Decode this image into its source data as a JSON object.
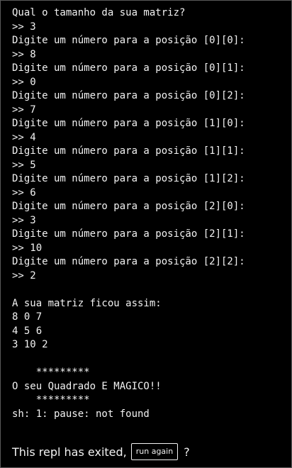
{
  "console": {
    "lines": [
      "Qual o tamanho da sua matriz?",
      ">> 3",
      "Digite um número para a posição [0][0]:",
      ">> 8",
      "Digite um número para a posição [0][1]:",
      ">> 0",
      "Digite um número para a posição [0][2]:",
      ">> 7",
      "Digite um número para a posição [1][0]:",
      ">> 4",
      "Digite um número para a posição [1][1]:",
      ">> 5",
      "Digite um número para a posição [1][2]:",
      ">> 6",
      "Digite um número para a posição [2][0]:",
      ">> 3",
      "Digite um número para a posição [2][1]:",
      ">> 10",
      "Digite um número para a posição [2][2]:",
      ">> 2",
      "",
      "A sua matriz ficou assim:",
      "8 0 7",
      "4 5 6",
      "3 10 2",
      "",
      "    *********",
      "O seu Quadrado E MAGICO!!",
      "    *********",
      "sh: 1: pause: not found"
    ]
  },
  "exit_bar": {
    "message": "This repl has exited,",
    "run_again_label": "run again",
    "question_mark": "?"
  }
}
